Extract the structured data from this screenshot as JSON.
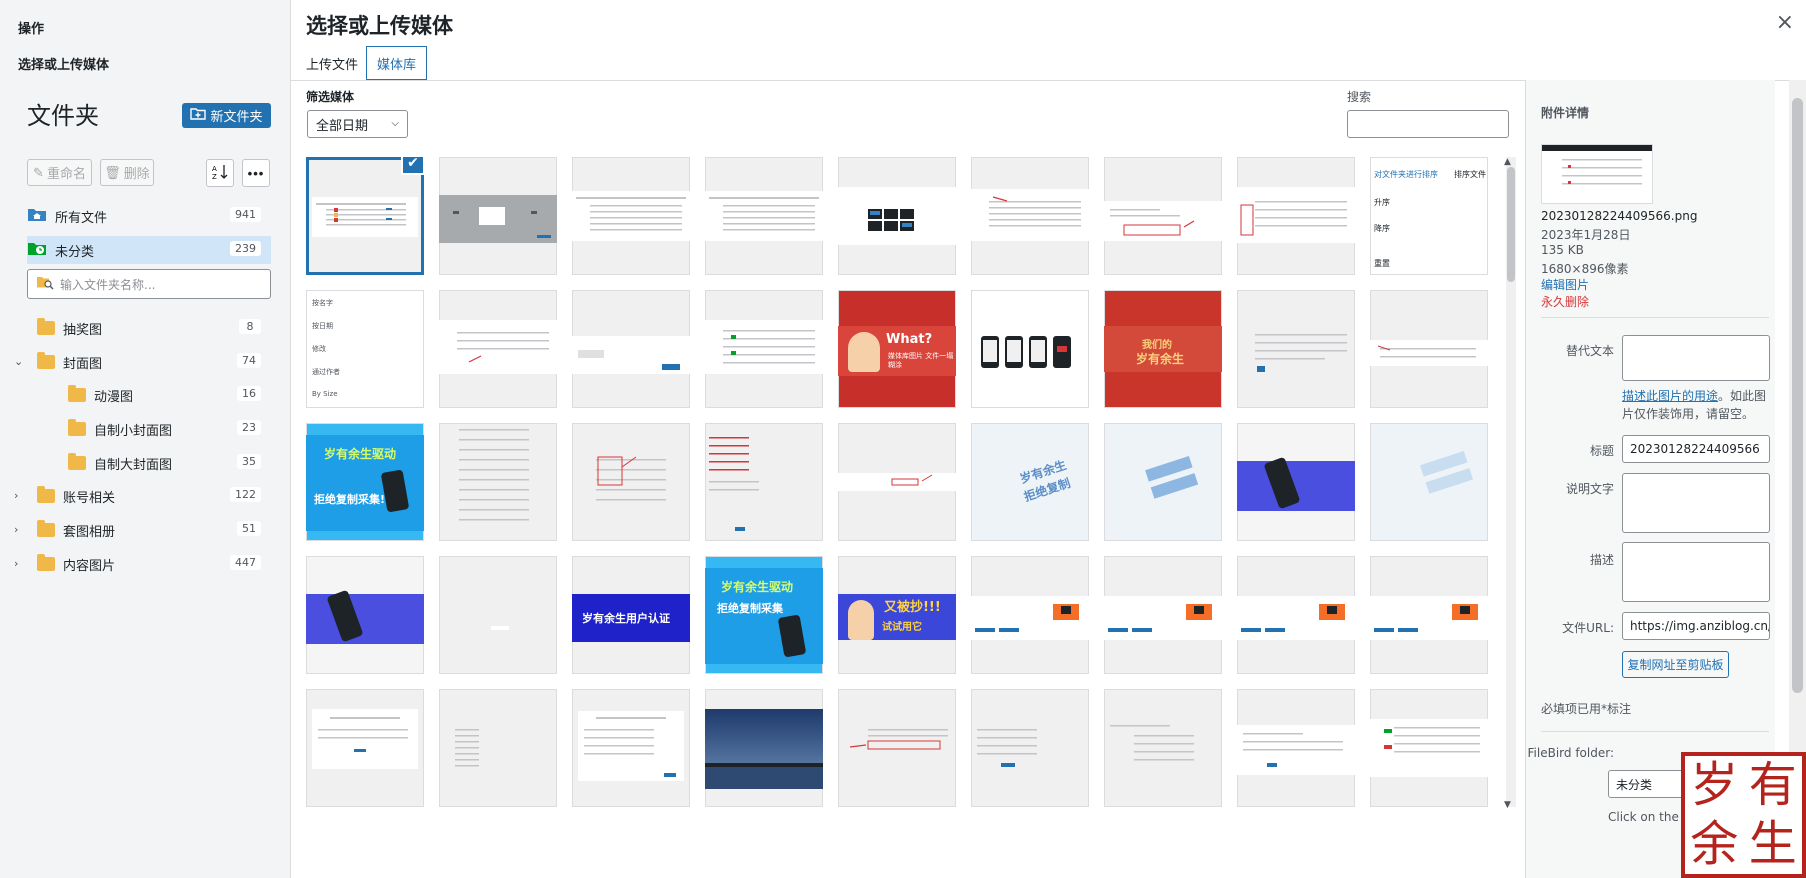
{
  "sidebar": {
    "actions_title": "操作",
    "modal_title": "选择或上传媒体",
    "folder_heading": "文件夹",
    "new_folder_label": "新文件夹",
    "rename_label": "重命名",
    "delete_label": "删除",
    "search_placeholder": "输入文件夹名称...",
    "all_files": {
      "label": "所有文件",
      "count": "941"
    },
    "uncategorized": {
      "label": "未分类",
      "count": "239"
    },
    "folders": [
      {
        "label": "抽奖图",
        "count": "8"
      },
      {
        "label": "封面图",
        "count": "74"
      },
      {
        "label": "动漫图",
        "count": "16"
      },
      {
        "label": "自制小封面图",
        "count": "23"
      },
      {
        "label": "自制大封面图",
        "count": "35"
      },
      {
        "label": "账号相关",
        "count": "122"
      },
      {
        "label": "套图相册",
        "count": "51"
      },
      {
        "label": "内容图片",
        "count": "447"
      }
    ]
  },
  "header": {
    "title": "选择或上传媒体",
    "close": "×",
    "tabs": [
      {
        "label": "上传文件"
      },
      {
        "label": "媒体库"
      }
    ]
  },
  "toolbar": {
    "filter_label": "筛选媒体",
    "date_filter": "全部日期",
    "search_label": "搜索"
  },
  "thumbnail_texts": {
    "t9_a": "对文件夹进行排序",
    "t9_b": "排序文件",
    "t9_c": "升序",
    "t9_d": "降序",
    "t9_e": "重置",
    "t10_a": "按名字",
    "t10_b": "按日期",
    "t10_c": "修改",
    "t10_d": "通过作者",
    "t10_e": "By Size",
    "t14_a": "What?",
    "t14_b": "媒体库图片 文件一塌糊涂",
    "t16_a": "我们的",
    "t16_b": "岁有余生",
    "t19_a": "岁有余生驱动",
    "t19_b": "拒绝复制采集!",
    "t23_a": "岁有余生",
    "t23_b": "拒绝复制",
    "t30_a": "岁有余生用户认证",
    "t31_a": "岁有余生驱动",
    "t31_b": "拒绝复制采集",
    "t32_a": "又被抄!!!",
    "t32_b": "试试用它"
  },
  "details": {
    "heading": "附件详情",
    "filename": "20230128224409566.png",
    "date": "2023年1月28日",
    "size": "135 KB",
    "dimensions": "1680×896像素",
    "edit_link": "编辑图片",
    "delete_link": "永久删除",
    "alt_label": "替代文本",
    "alt_help_link": "描述此图片的用途",
    "alt_help_text": "。如此图片仅作装饰用，请留空。",
    "title_label": "标题",
    "title_value": "20230128224409566",
    "caption_label": "说明文字",
    "desc_label": "描述",
    "url_label": "文件URL:",
    "url_value": "https://img.anziblog.cn/",
    "copy_label": "复制网址至剪贴板",
    "required_note": "必填项已用*标注",
    "filebird_label": "FileBird folder:",
    "filebird_value": "未分类",
    "click_hint": "Click on the"
  },
  "seal": {
    "chars": [
      "岁",
      "有",
      "余",
      "生"
    ]
  },
  "colors": {
    "accent": "#2271b1",
    "danger": "#d63638",
    "folder": "#f0b849",
    "seal": "#b4241d"
  }
}
